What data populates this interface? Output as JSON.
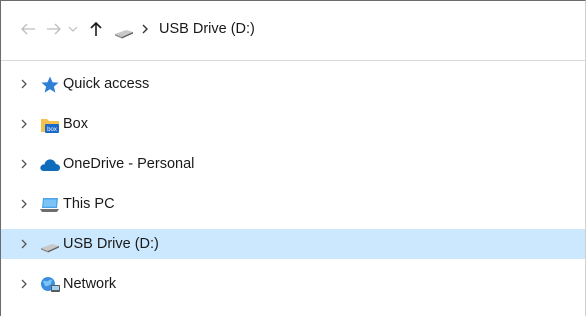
{
  "addressbar": {
    "back_icon": "arrow-left-icon",
    "forward_icon": "arrow-right-icon",
    "recent_icon": "chevron-down-icon",
    "up_icon": "arrow-up-icon",
    "drive_icon": "usb-drive-icon",
    "separator_icon": "chevron-right-icon",
    "path": "USB Drive (D:)"
  },
  "navigation_pane": {
    "items": [
      {
        "label": "Quick access",
        "icon": "star-icon",
        "selected": false
      },
      {
        "label": "Box",
        "icon": "box-folder-icon",
        "icon_text": "box",
        "selected": false
      },
      {
        "label": "OneDrive - Personal",
        "icon": "cloud-icon",
        "selected": false
      },
      {
        "label": "This PC",
        "icon": "computer-icon",
        "selected": false
      },
      {
        "label": "USB Drive (D:)",
        "icon": "usb-drive-icon",
        "selected": true
      },
      {
        "label": "Network",
        "icon": "network-icon",
        "selected": false
      }
    ]
  },
  "colors": {
    "selection_background": "#cce8ff",
    "quick_access_star": "#2f7fd6",
    "box_folder": "#f2c14e",
    "box_badge": "#1b6ac9",
    "onedrive_cloud": "#0f6cbd",
    "disabled_nav": "#bdbdbd"
  }
}
